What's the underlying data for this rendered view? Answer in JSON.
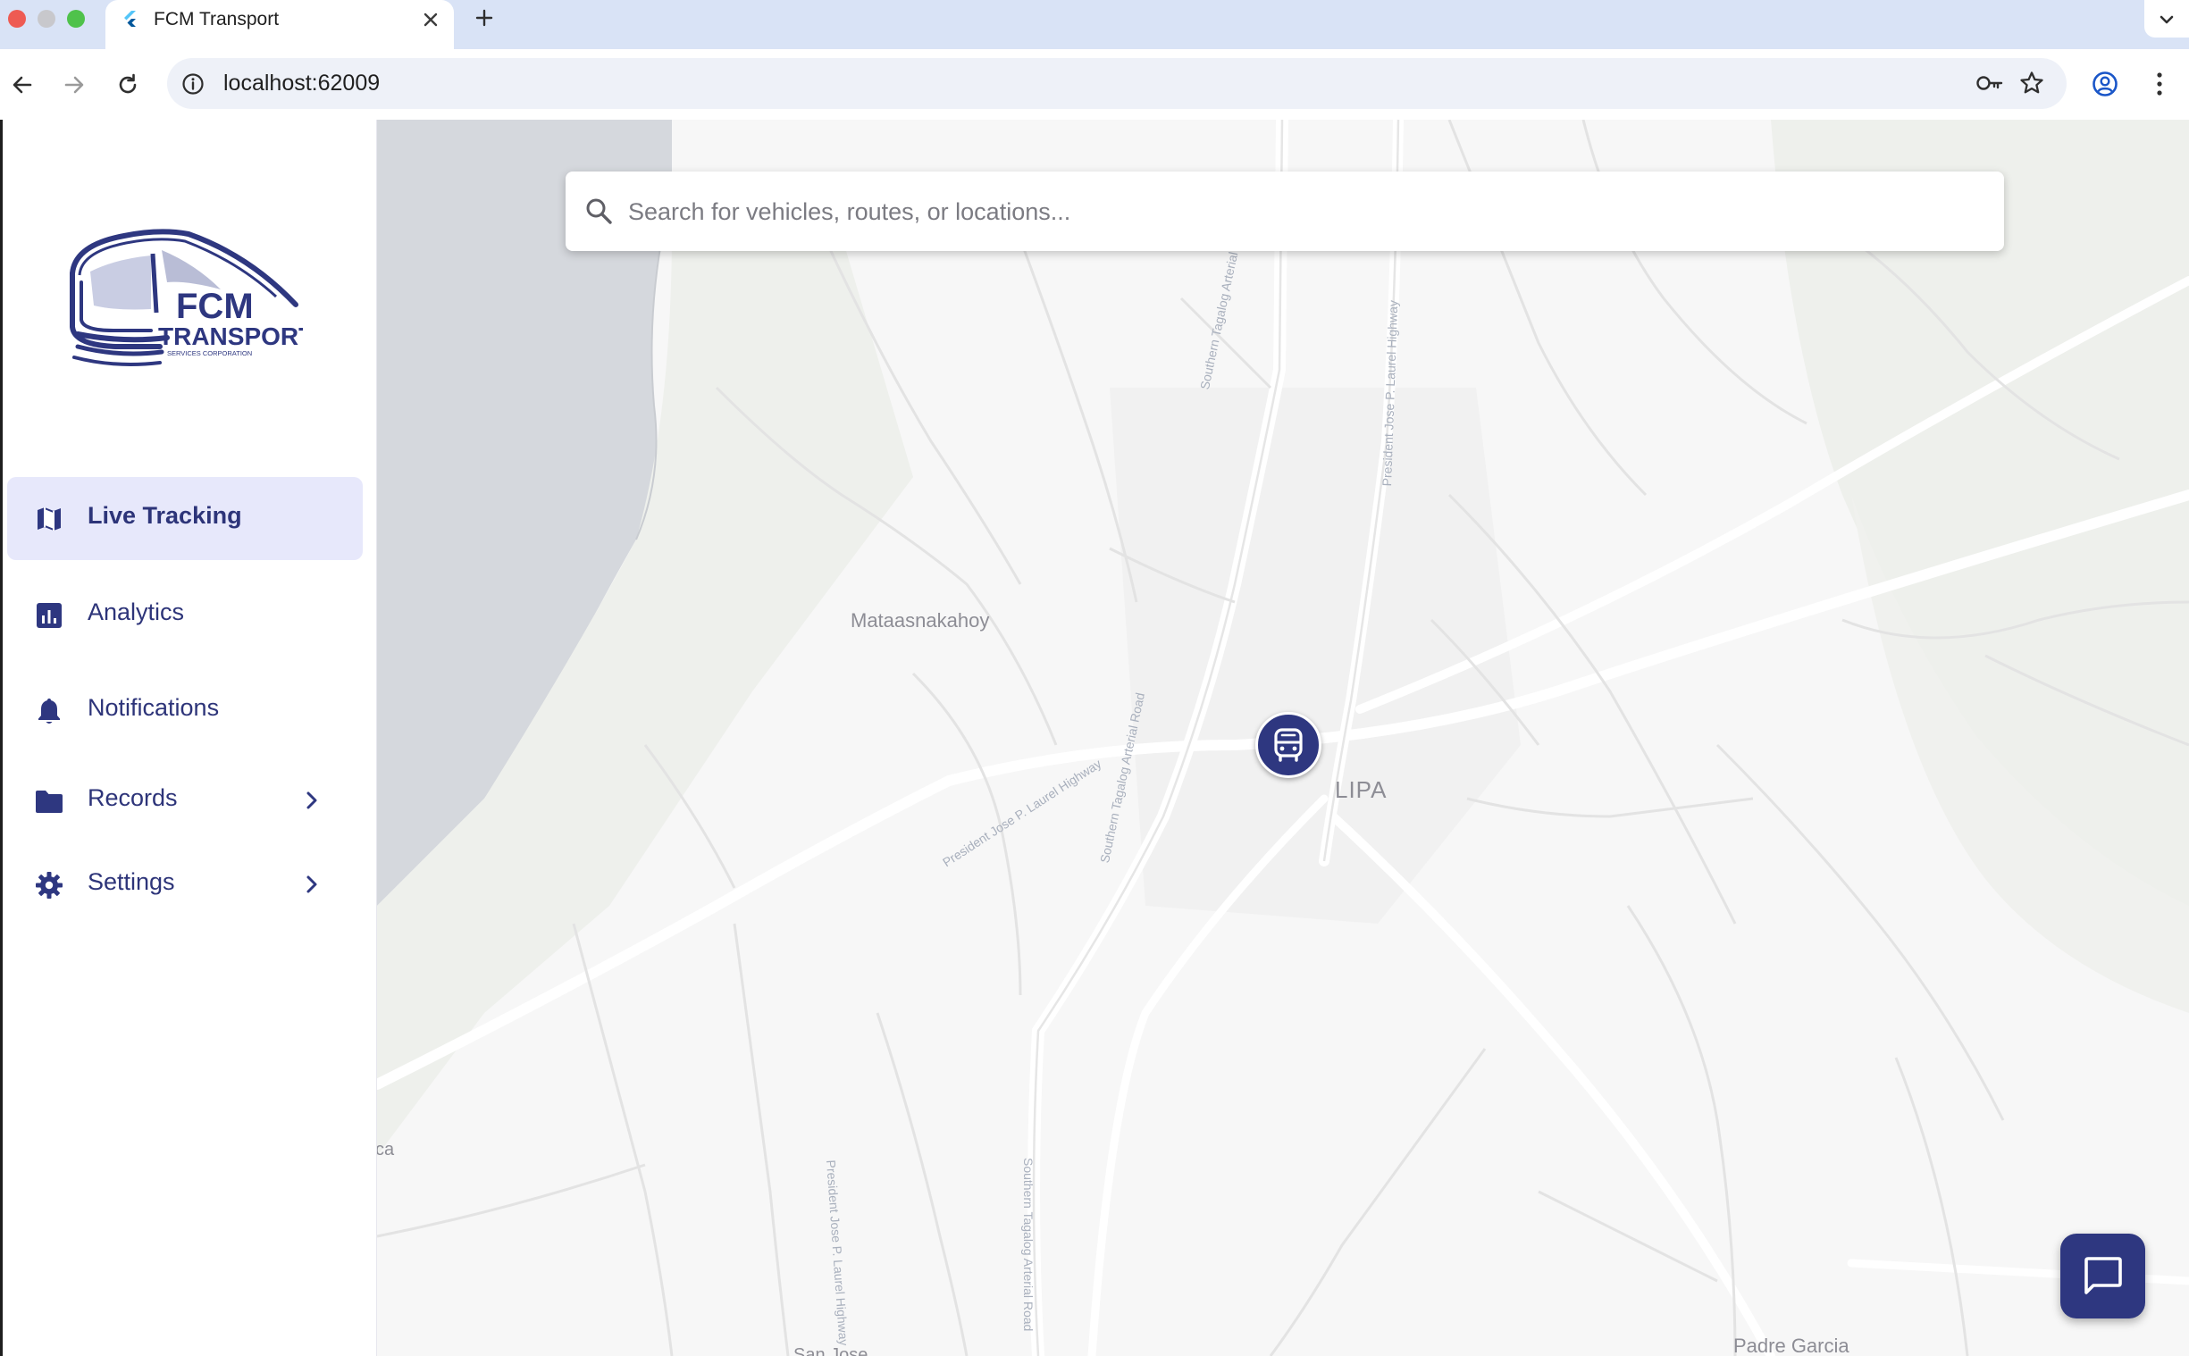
{
  "browser": {
    "tab_title": "FCM Transport",
    "url": "localhost:62009"
  },
  "brand": {
    "logo_line1": "FCM",
    "logo_line2": "TRANSPORT",
    "logo_line3": "SERVICES CORPORATION",
    "primary_color": "#2e3780",
    "active_bg": "#e7e8fb"
  },
  "sidebar": {
    "items": [
      {
        "label": "Live Tracking",
        "icon": "map-icon",
        "active": true
      },
      {
        "label": "Analytics",
        "icon": "bar-chart-icon",
        "active": false
      },
      {
        "label": "Notifications",
        "icon": "bell-icon",
        "active": false
      },
      {
        "label": "Records",
        "icon": "folder-icon",
        "active": false,
        "has_children": true
      },
      {
        "label": "Settings",
        "icon": "gear-icon",
        "active": false,
        "has_children": true
      }
    ]
  },
  "search": {
    "placeholder": "Search for vehicles, routes, or locations..."
  },
  "map": {
    "places": {
      "mataas": "Mataasnakahoy",
      "lipa": "LIPA",
      "padre": "Padre Garcia",
      "ca": "ca",
      "sanjose": "San Jose"
    },
    "roads": {
      "r1": "Southern Tagalog Arterial Road",
      "r2": "President Jose P. Laurel Highway",
      "r3": "Southern Tagalog Arterial Road",
      "r4": "President Jose P. Laurel Highway",
      "r5": "President Jose P. Laurel Highway",
      "r6": "Southern Tagalog Arterial Road"
    }
  }
}
